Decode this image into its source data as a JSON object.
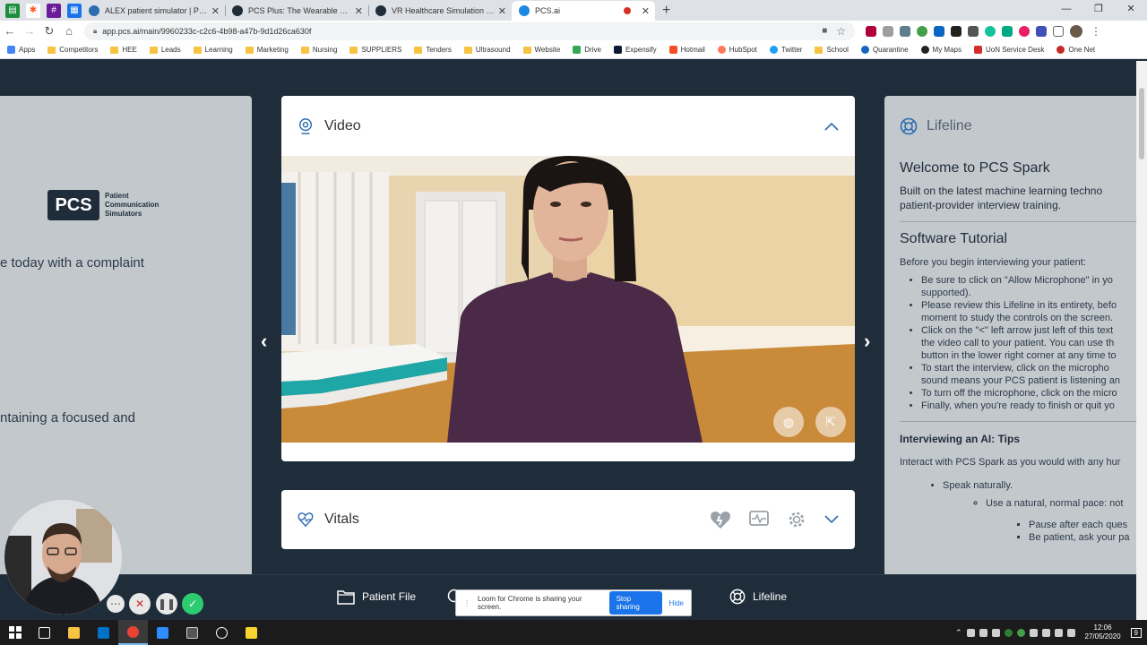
{
  "browser": {
    "tabs": [
      {
        "title": "ALEX patient simulator | Patient C",
        "favicon_color": "#2b6cb0"
      },
      {
        "title": "PCS Plus: The Wearable Simulato",
        "favicon_color": "#1f2d3a"
      },
      {
        "title": "VR Healthcare Simulation | Medic",
        "favicon_color": "#1f2d3a"
      },
      {
        "title": "PCS.ai",
        "favicon_color": "#1e88e5",
        "active": true
      }
    ],
    "url": "app.pcs.ai/main/9960233c-c2c6-4b98-a47b-9d1d26ca630f",
    "bookmarks": [
      "Apps",
      "Competitors",
      "HEE",
      "Leads",
      "Learning",
      "Marketing",
      "Nursing",
      "SUPPLIERS",
      "Tenders",
      "Ultrasound",
      "Website",
      "Drive",
      "Expensify",
      "Hotmail",
      "HubSpot",
      "Twitter",
      "School",
      "Quarantine",
      "My Maps",
      "UoN Service Desk",
      "One Net"
    ]
  },
  "left_panel": {
    "logo_mark": "PCS",
    "logo_text_1": "Patient",
    "logo_text_2": "Communication",
    "logo_text_3": "Simulators",
    "text_1": "e today with a complaint",
    "text_2": "ntaining a focused and"
  },
  "video_card": {
    "title": "Video"
  },
  "vitals_card": {
    "title": "Vitals"
  },
  "lifeline": {
    "label": "Lifeline",
    "welcome": "Welcome to PCS Spark",
    "intro": "Built on the latest machine learning techno patient-provider interview training.",
    "tutorial_title": "Software Tutorial",
    "tutorial_lead": "Before you begin interviewing your patient:",
    "tutorial_items": [
      "Be sure to click on \"Allow Microphone\" in yo",
      "supported).",
      "Please review this Lifeline in its entirety, befo",
      "moment to study the controls on the screen.",
      "Click on the \"<\" left arrow just left of this text",
      "the video call to your patient. You can use th",
      "button in the lower right corner at any time to",
      "To start the interview, click on the micropho",
      "sound means your PCS patient is listening an",
      "To turn off the microphone, click on the micro",
      "Finally, when you're ready to finish or quit yo"
    ],
    "tips_title": "Interviewing an AI: Tips",
    "tips_lead": "Interact with PCS Spark as you would with any hur",
    "tip_1": "Speak naturally.",
    "tip_2": "Use a natural, normal pace: not",
    "tip_3": "Pause after each ques",
    "tip_4": "Be patient, ask your pa"
  },
  "bottom_nav": {
    "patient_file": "Patient File",
    "lifeline": "Lifeline"
  },
  "loom": {
    "message": "Loom for Chrome is sharing your screen.",
    "stop": "Stop sharing",
    "hide": "Hide"
  },
  "taskbar": {
    "time": "12:06",
    "date": "27/05/2020",
    "notifications": "9"
  }
}
